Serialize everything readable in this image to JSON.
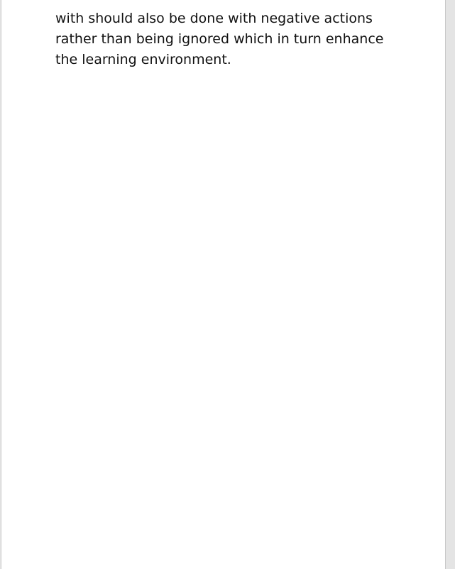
{
  "document": {
    "paragraph_lines": [
      "with should also be done with negative actions",
      "rather than being ignored which in turn enhance",
      "the learning environment."
    ]
  }
}
